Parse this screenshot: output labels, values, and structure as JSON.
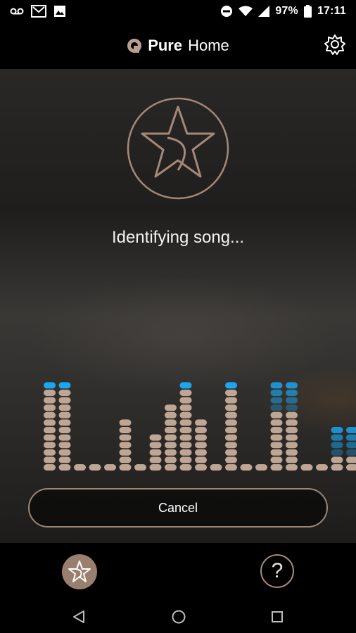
{
  "status_bar": {
    "battery": "97%",
    "time": "17:11",
    "icons": [
      "voicemail-icon",
      "gmail-icon",
      "image-icon",
      "do-not-disturb-icon",
      "wifi-icon",
      "signal-icon",
      "battery-icon"
    ]
  },
  "app_bar": {
    "title_bold": "Pure",
    "title_rest": "Home",
    "settings_icon": "settings-gear-icon"
  },
  "main": {
    "logo_icon": "star-listen-icon",
    "status_text": "Identifying song...",
    "visualizer_icon": "audio-level-meter",
    "cancel_label": "Cancel"
  },
  "tabs": [
    {
      "icon": "star-identify-icon",
      "active": true
    },
    {
      "icon": "help-icon",
      "label": "?"
    }
  ],
  "nav": [
    "back-icon",
    "home-icon",
    "recents-icon"
  ],
  "colors": {
    "accent_tan": "#bfa593",
    "accent_blue": "#1aa6f0",
    "outline_tan": "#9b8778"
  }
}
